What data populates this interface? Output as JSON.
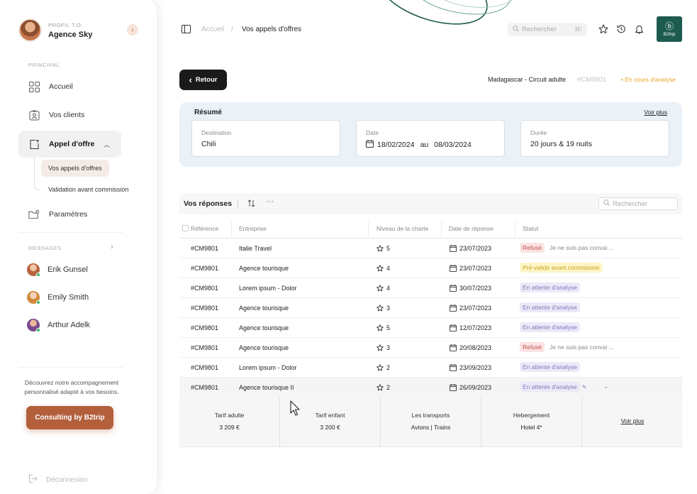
{
  "profile": {
    "role": "PROFIL T.O.",
    "name": "Agence Sky"
  },
  "sidebar": {
    "principal_label": "PRINCIPAL",
    "items": [
      {
        "label": "Accueil",
        "icon": "grid-icon"
      },
      {
        "label": "Vos clients",
        "icon": "contact-icon"
      },
      {
        "label": "Appel d'offre",
        "icon": "document-plus-icon"
      },
      {
        "label": "Paramètres",
        "icon": "folder-settings-icon"
      }
    ],
    "subitems": [
      "Vos appels d'offres",
      "Validation avant commission"
    ],
    "messages_label": "MESSAGES",
    "messages": [
      {
        "name": "Erik Gunsel"
      },
      {
        "name": "Emily Smith"
      },
      {
        "name": "Arthur Adelk"
      }
    ],
    "promo_text": "Découvrez notre accompagnement personnalisé adapté à vos besoins.",
    "promo_button": "Consulting by B2trip",
    "logout": "Déconnexion"
  },
  "topbar": {
    "breadcrumb_home": "Accueil",
    "breadcrumb_sep": "/",
    "breadcrumb_current": "Vos appels d'offres",
    "search_placeholder": "Rechercher",
    "search_shortcut": "⌘/",
    "brand": "B2trip"
  },
  "header": {
    "back_label": "Retour",
    "trip_title": "Madagascar - Circuit adulte",
    "trip_ref": "#CM9801",
    "trip_status": "• En cours d'analyse"
  },
  "resume": {
    "title": "Résumé",
    "more": "Voir plus",
    "destination_label": "Destination",
    "destination_value": "Chili",
    "date_label": "Date",
    "date_from": "18/02/2024",
    "date_to_word": "au",
    "date_to": "08/03/2024",
    "duration_label": "Durée",
    "duration_value": "20 jours & 19 nuits"
  },
  "table": {
    "title": "Vos réponses",
    "search_placeholder": "Rechercher",
    "columns": [
      "Référence",
      "Entreprise",
      "Niveau de la charte",
      "Date de réponse",
      "Statut"
    ],
    "rows": [
      {
        "ref": "#CM9801",
        "company": "Italie Travel",
        "stars": "5",
        "date": "23/07/2023",
        "status": "Refusé",
        "status_type": "refuse",
        "note": "Je ne suis pas convai ..."
      },
      {
        "ref": "#CM9801",
        "company": "Agence tourisque",
        "stars": "4",
        "date": "23/07/2023",
        "status": "Pré-validé avant commission",
        "status_type": "prev",
        "note": ""
      },
      {
        "ref": "#CM9801",
        "company": "Lorem ipsum - Dolor",
        "stars": "4",
        "date": "30/07/2023",
        "status": "En attente d'analyse",
        "status_type": "wait",
        "note": ""
      },
      {
        "ref": "#CM9801",
        "company": "Agence tourisque",
        "stars": "3",
        "date": "23/07/2023",
        "status": "En attente d'analyse",
        "status_type": "wait",
        "note": ""
      },
      {
        "ref": "#CM9801",
        "company": "Agence tourisque",
        "stars": "5",
        "date": "12/07/2023",
        "status": "En attente d'analyse",
        "status_type": "wait",
        "note": ""
      },
      {
        "ref": "#CM9801",
        "company": "Agence tourisque",
        "stars": "3",
        "date": "20/08/2023",
        "status": "Refusé",
        "status_type": "refuse",
        "note": "Je ne suis pas convai ..."
      },
      {
        "ref": "#CM9801",
        "company": "Lorem ipsum - Dolor",
        "stars": "2",
        "date": "23/09/2023",
        "status": "En attente d'analyse",
        "status_type": "wait",
        "note": ""
      },
      {
        "ref": "#CM9801",
        "company": "Agence tourisque II",
        "stars": "2",
        "date": "26/09/2023",
        "status": "En attente d'analyse",
        "status_type": "wait",
        "note": ""
      }
    ],
    "detail": {
      "cells": [
        {
          "label": "Tarif adulte",
          "value": "3 209 €"
        },
        {
          "label": "Tarif enfant",
          "value": "3 200 €"
        },
        {
          "label": "Les transports",
          "value": "Avions | Trains"
        },
        {
          "label": "Hebergement",
          "value": "Hotel 4*"
        }
      ],
      "more": "Voir plus"
    }
  },
  "colors": {
    "accent": "#b35f3c",
    "brand": "#1e5b4f",
    "resume_bg": "#eaf1f7",
    "status_pending": "#e7a323"
  }
}
